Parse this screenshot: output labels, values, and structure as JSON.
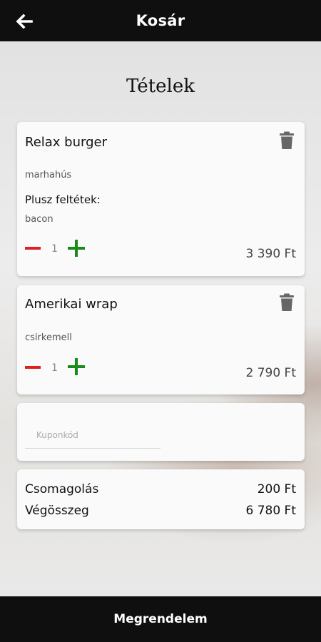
{
  "header": {
    "title": "Kosár"
  },
  "section_title": "Tételek",
  "items": [
    {
      "name": "Relax burger",
      "base": "marhahús",
      "extras_label": "Plusz feltétek:",
      "extras": "bacon",
      "quantity": "1",
      "price": "3 390 Ft"
    },
    {
      "name": "Amerikai wrap",
      "base": "csirkemell",
      "quantity": "1",
      "price": "2 790 Ft"
    }
  ],
  "coupon": {
    "placeholder": "Kuponkód"
  },
  "summary": {
    "packaging_label": "Csomagolás",
    "packaging_value": "200 Ft",
    "total_label": "Végösszeg",
    "total_value": "6 780 Ft"
  },
  "footer": {
    "order_button": "Megrendelem"
  },
  "colors": {
    "minus": "#e02020",
    "plus": "#1a8a1a",
    "bar": "#0f0f0f"
  },
  "icons": {
    "back": "arrow-left-icon",
    "delete": "trash-icon",
    "decrease": "minus-icon",
    "increase": "plus-icon"
  }
}
